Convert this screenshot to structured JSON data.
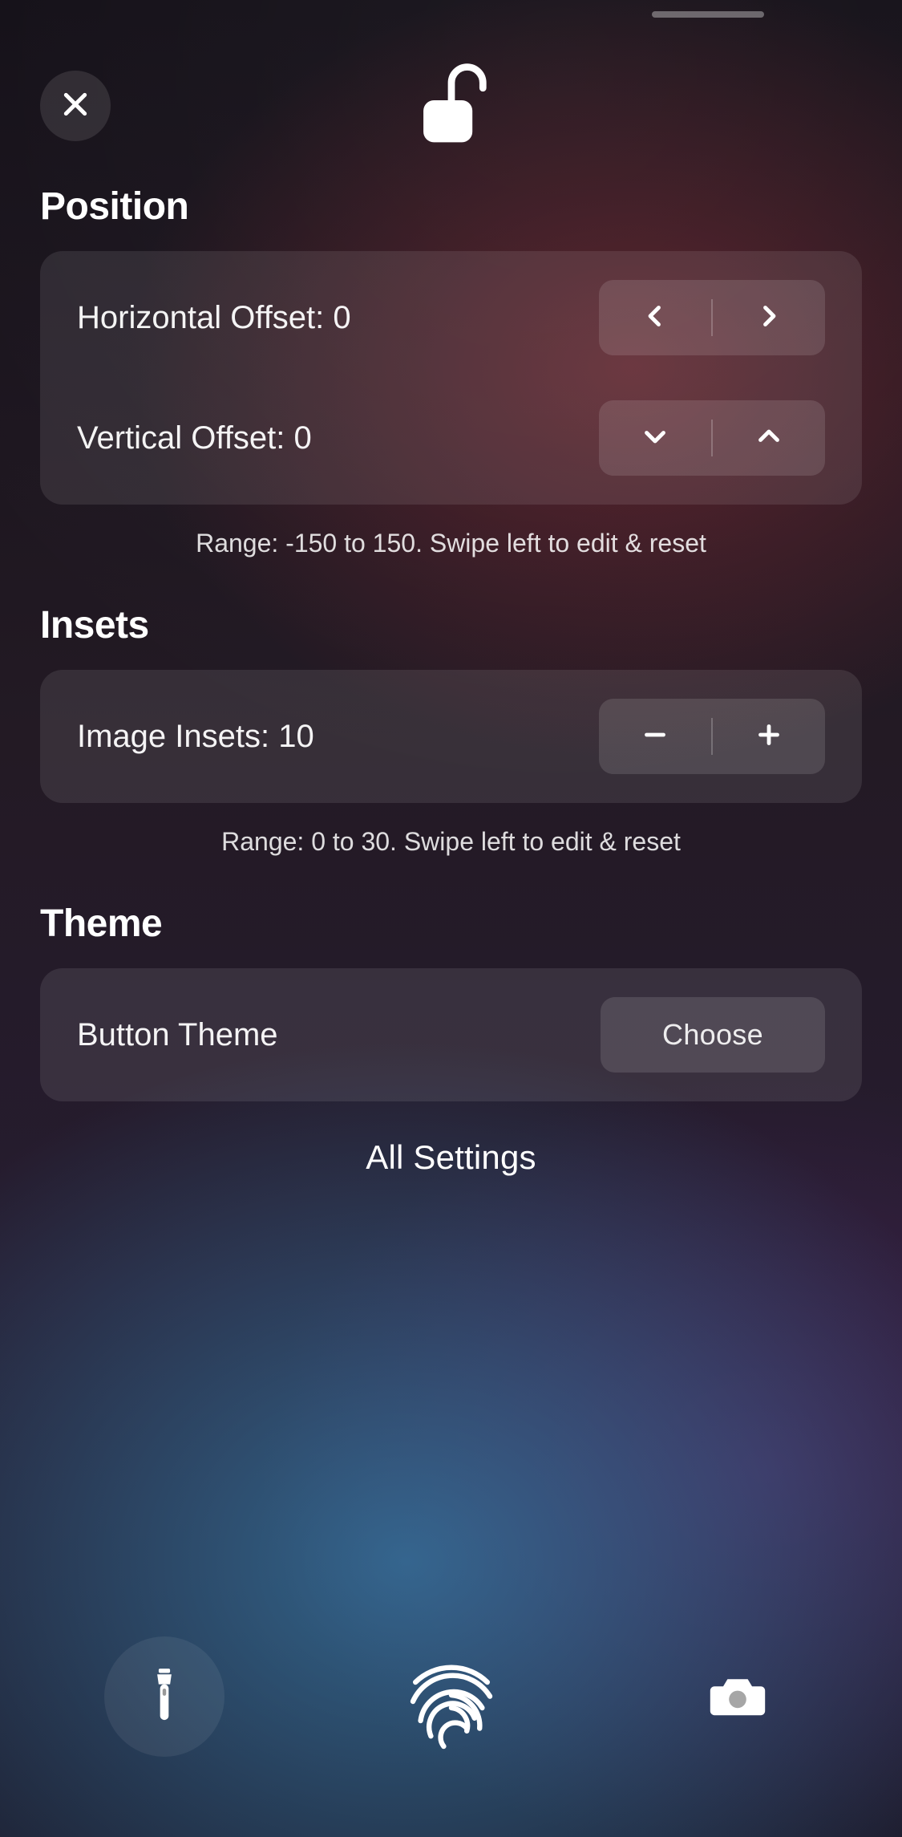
{
  "sections": {
    "position": {
      "title": "Position",
      "horizontal_label": "Horizontal Offset: 0",
      "vertical_label": "Vertical Offset: 0",
      "note": "Range: -150 to 150. Swipe left to edit & reset"
    },
    "insets": {
      "title": "Insets",
      "image_insets_label": "Image Insets: 10",
      "note": "Range: 0 to 30. Swipe left to edit & reset"
    },
    "theme": {
      "title": "Theme",
      "button_theme_label": "Button Theme",
      "choose_label": "Choose"
    }
  },
  "all_settings_label": "All Settings"
}
